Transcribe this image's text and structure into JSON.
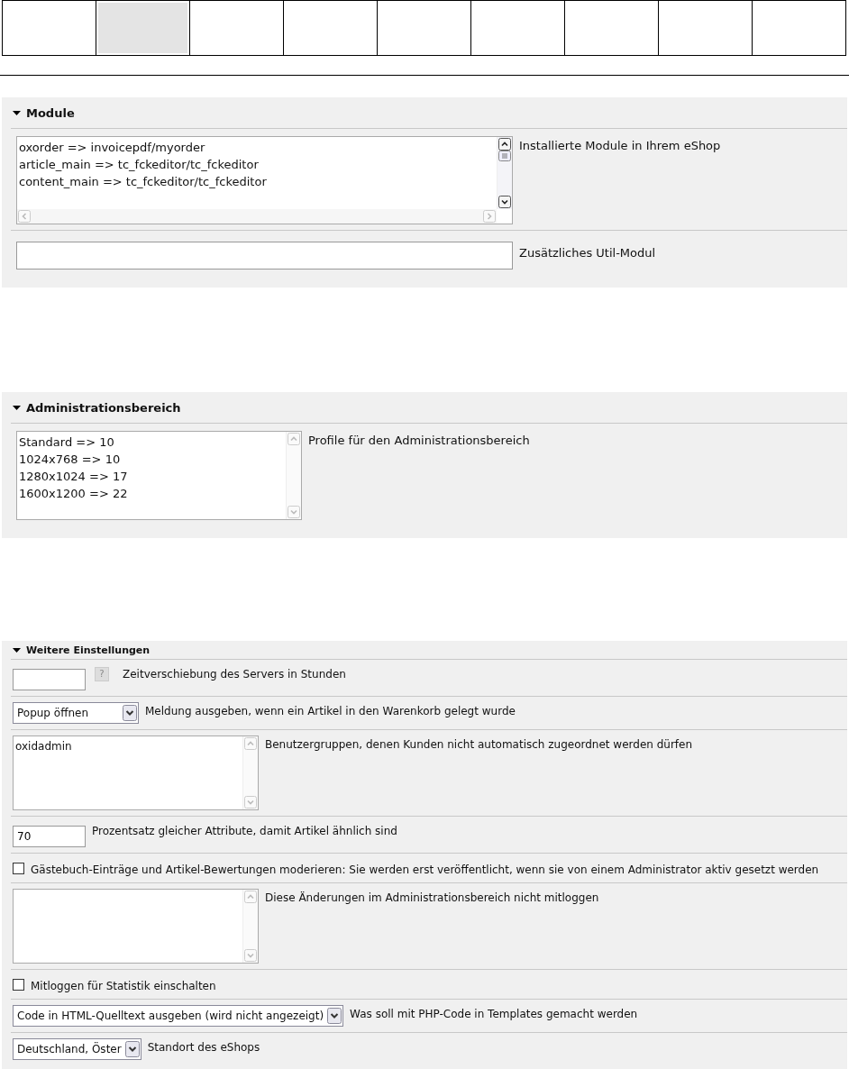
{
  "tabs": [
    {
      "selected": false
    },
    {
      "selected": true
    },
    {
      "selected": false
    },
    {
      "selected": false
    },
    {
      "selected": false
    },
    {
      "selected": false
    },
    {
      "selected": false
    },
    {
      "selected": false
    },
    {
      "selected": false
    }
  ],
  "sections": [
    {
      "title": "Module",
      "expanded": true,
      "rows": [
        {
          "kind": "listbox",
          "lines": [
            "oxorder => invoicepdf/myorder",
            "article_main => tc_fckeditor/tc_fckeditor",
            "content_main => tc_fckeditor/tc_fckeditor"
          ],
          "label": "Installierte Module in Ihrem eShop"
        },
        {
          "kind": "wide-text",
          "label": "Zusätzliches Util-Modul"
        }
      ]
    },
    {
      "title": "Administrationsbereich",
      "expanded": true,
      "rows": [
        {
          "kind": "textarea",
          "lines": [
            "Standard => 10",
            "1024x768 => 10",
            "1280x1024 => 17",
            "1600x1200 => 22"
          ],
          "label": "Profile für den Administrationsbereich"
        }
      ]
    },
    {
      "title": "Weitere Einstellungen",
      "expanded": true,
      "rows": [
        {
          "kind": "text",
          "help": "?",
          "label": "Zeitverschiebung des Servers in Stunden"
        },
        {
          "kind": "select",
          "value": "Popup öffnen",
          "label": "Meldung ausgeben, wenn ein Artikel in den Warenkorb gelegt wurde"
        },
        {
          "kind": "textarea",
          "lines": [
            "oxidadmin"
          ],
          "label": "Benutzergruppen, denen Kunden nicht automatisch zugeordnet werden dürfen"
        },
        {
          "kind": "text",
          "value": "70",
          "label": "Prozentsatz gleicher Attribute, damit Artikel ähnlich sind"
        },
        {
          "kind": "checkbox",
          "checked": false,
          "label": "Gästebuch-Einträge und Artikel-Bewertungen moderieren: Sie werden erst veröffentlicht, wenn sie von einem Administrator aktiv gesetzt werden"
        },
        {
          "kind": "textarea",
          "label": "Diese Änderungen im Administrationsbereich nicht mitloggen"
        },
        {
          "kind": "checkbox",
          "checked": false,
          "label": "Mitloggen für Statistik einschalten"
        },
        {
          "kind": "select",
          "value": "Code in HTML-Quelltext ausgeben (wird nicht angezeigt)",
          "label": "Was soll mit PHP-Code in Templates gemacht werden"
        },
        {
          "kind": "select",
          "value": "Deutschland, Öster",
          "label": "Standort des eShops"
        }
      ]
    }
  ]
}
